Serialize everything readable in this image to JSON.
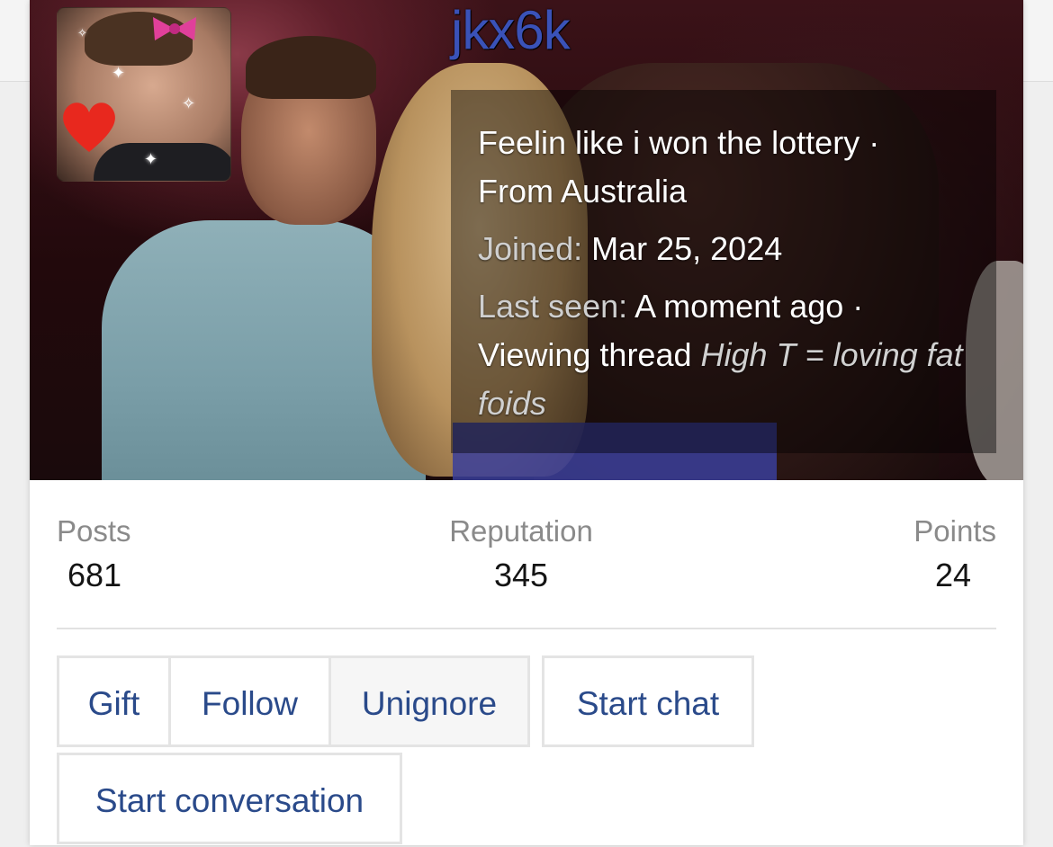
{
  "profile": {
    "username": "jkx6k",
    "custom_title": "Feelin like i won the lottery",
    "location": "From Australia",
    "joined_label": "Joined:",
    "joined_value": "Mar 25, 2024",
    "last_seen_label": "Last seen:",
    "last_seen_value": "A moment ago",
    "activity_prefix": "Viewing thread",
    "activity_thread": "High T = loving fat foids",
    "separator": "·"
  },
  "stats": [
    {
      "label": "Posts",
      "value": "681"
    },
    {
      "label": "Reputation",
      "value": "345"
    },
    {
      "label": "Points",
      "value": "24"
    }
  ],
  "actions": {
    "gift": "Gift",
    "follow": "Follow",
    "unignore": "Unignore",
    "start_chat": "Start chat",
    "start_conversation": "Start conversation"
  },
  "colors": {
    "username": "#3a52b8",
    "button_text": "#2a4a8a"
  }
}
